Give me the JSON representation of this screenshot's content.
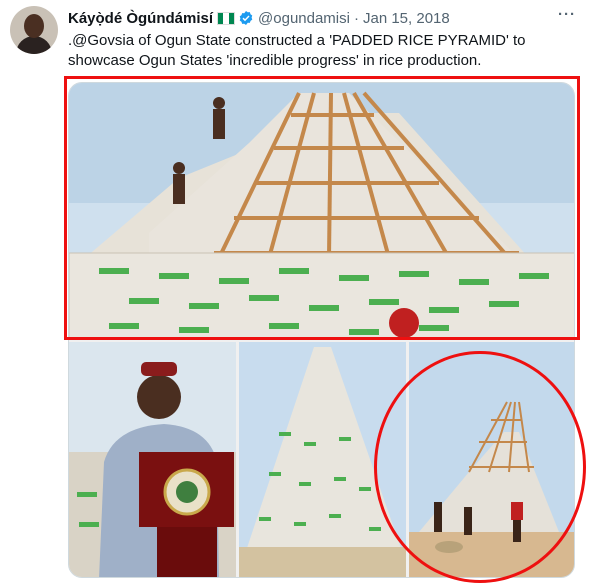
{
  "tweet": {
    "author_name": "Káyọ̀dé Ògúndámisí",
    "flag_icon": "nigeria-flag",
    "verified_icon": "verified-badge-icon",
    "handle": "@ogundamisi",
    "separator": "·",
    "date": "Jan 15, 2018",
    "more_icon": "more-options-icon",
    "text": ".@Govsia of Ogun State constructed a 'PADDED RICE PYRAMID' to showcase Ogun States 'incredible progress' in rice production."
  },
  "media": {
    "photos": [
      {
        "subject": "rice-bag-pyramid-with-wooden-frame"
      },
      {
        "subject": "governor-speaking-at-podium"
      },
      {
        "subject": "completed-rice-bag-pyramid"
      },
      {
        "subject": "rice-pyramid-under-construction"
      }
    ]
  },
  "colors": {
    "annotation": "#ee1010",
    "verified": "#1d9bf0",
    "flag_green": "#008751",
    "text": "#0f1419",
    "muted": "#536471"
  }
}
